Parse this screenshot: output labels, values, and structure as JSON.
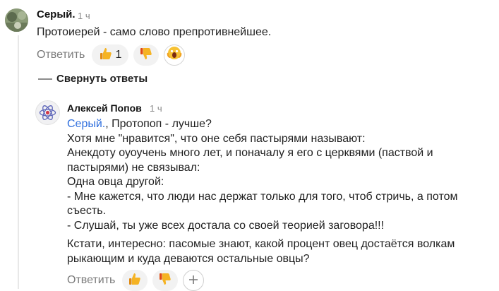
{
  "comment": {
    "author": "Серый.",
    "time": "1 ч",
    "text": "Протоиерей - само слово препротивнейшее.",
    "reply_label": "Ответить",
    "like_count": "1"
  },
  "collapse_label": "Свернуть ответы",
  "reply": {
    "author": "Алексей Попов",
    "time": "1 ч",
    "mention": "Серый.",
    "first_line_rest": ", Протопоп - лучше?",
    "lines": [
      "Хотя мне \"нравится\", что оне себя пастырями называют:",
      "Анекдоту оуоучень много лет, и поначалу я его с церквями (паствой и",
      "пастырями) не связывал:",
      "Одна овца другой:",
      "- Мне кажется, что люди нас держат только для того, чтоб стричь, а потом",
      "съесть.",
      "- Слушай, ты уже всех достала со своей теорией заговора!!!"
    ],
    "paragraph2": [
      "Кстати, интересно: пасомые знают, какой процент овец достаётся волкам",
      "рыкающим и куда деваются остальные овцы?"
    ],
    "reply_label": "Ответить"
  },
  "colors": {
    "mention": "#2f6fde",
    "thread_line": "#e8e8e8",
    "pill_bg": "#f2f2f2"
  },
  "icons": [
    "thumbs-up-icon",
    "thumbs-down-icon",
    "screaming-face-icon",
    "plus-icon",
    "atom-avatar-icon"
  ]
}
